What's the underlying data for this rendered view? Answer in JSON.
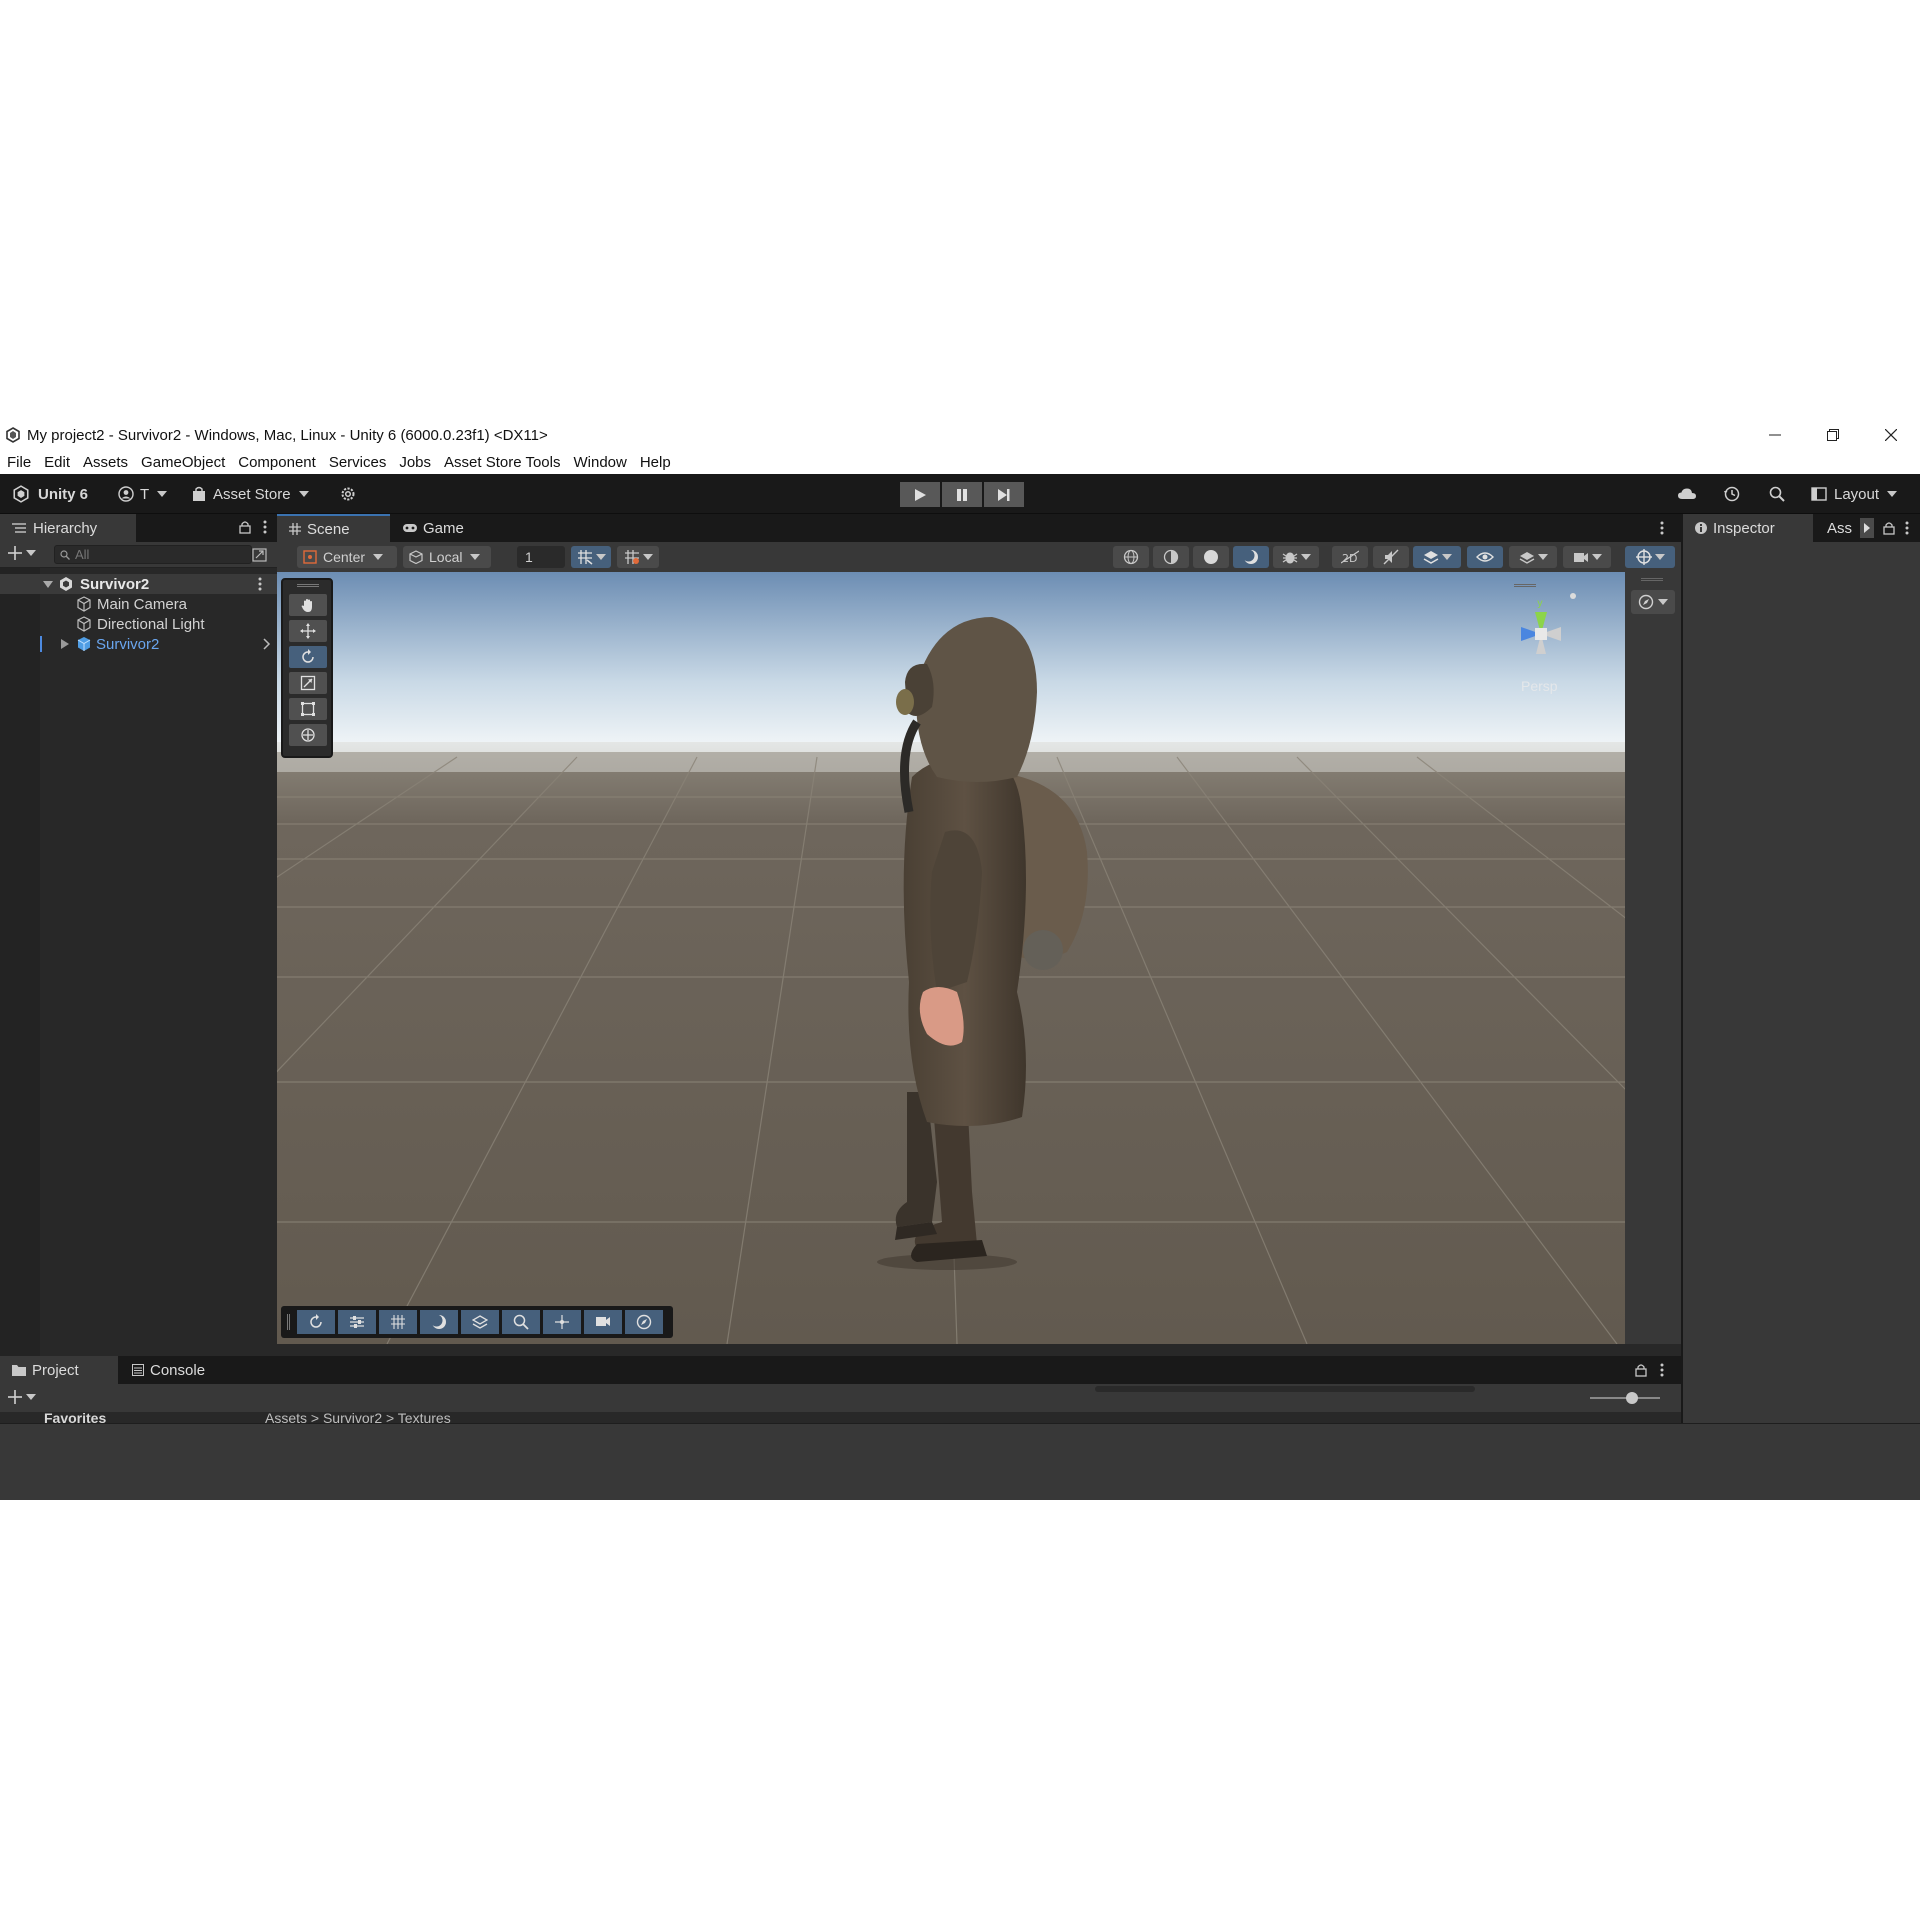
{
  "window": {
    "title": "My project2 - Survivor2 - Windows, Mac, Linux - Unity 6 (6000.0.23f1) <DX11>"
  },
  "menu": [
    "File",
    "Edit",
    "Assets",
    "GameObject",
    "Component",
    "Services",
    "Jobs",
    "Asset Store Tools",
    "Window",
    "Help"
  ],
  "toolbar": {
    "brand": "Unity 6",
    "account": "T",
    "asset_store": "Asset Store",
    "layout": "Layout"
  },
  "hierarchy": {
    "tab": "Hierarchy",
    "search_placeholder": "All",
    "scene_name": "Survivor2",
    "items": [
      "Main Camera",
      "Directional Light",
      "Survivor2"
    ]
  },
  "scene": {
    "tabs": [
      "Scene",
      "Game"
    ],
    "pivot": "Center",
    "space": "Local",
    "grid_value": "1",
    "projection": "Persp"
  },
  "inspector": {
    "tabs": [
      "Inspector",
      "Ass"
    ]
  },
  "project": {
    "tabs": [
      "Project",
      "Console"
    ],
    "favorites": "Favorites",
    "breadcrumb": "Assets > Survivor2 > Textures"
  },
  "colors": {
    "accent_blue": "#46607c",
    "selected_text": "#6aa6ef",
    "editor_dark": "#191919",
    "panel": "#383838"
  }
}
